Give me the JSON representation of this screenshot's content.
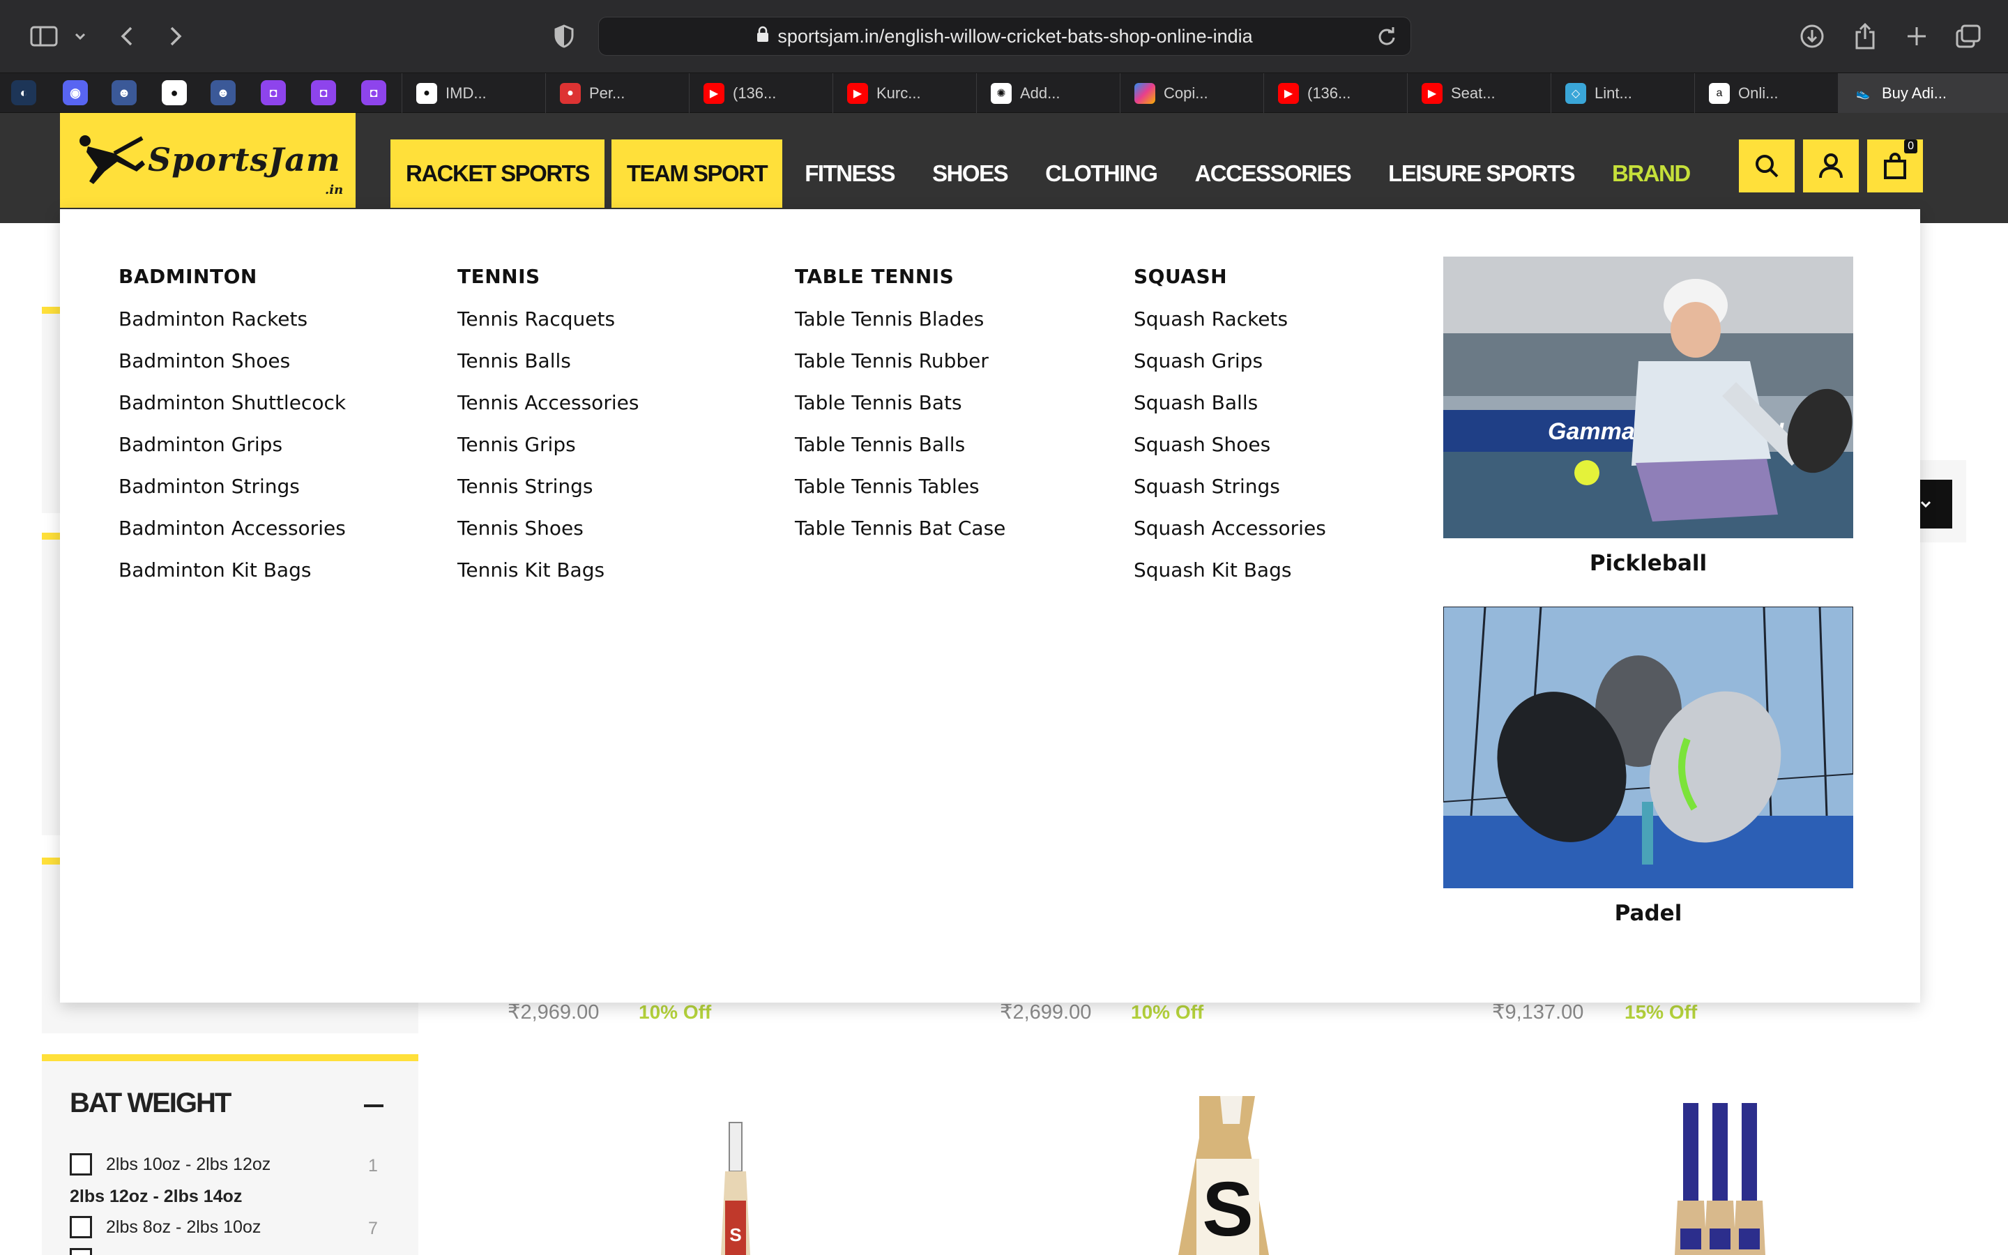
{
  "browser": {
    "url": "sportsjam.in/english-willow-cricket-bats-shop-online-india",
    "tabs": [
      {
        "label": "IMD...",
        "icon": "github-icon"
      },
      {
        "label": "Per...",
        "icon": "app-icon"
      },
      {
        "label": "(136...",
        "icon": "youtube-icon"
      },
      {
        "label": "Kurc...",
        "icon": "youtube-icon"
      },
      {
        "label": "Add...",
        "icon": "openai-icon"
      },
      {
        "label": "Copi...",
        "icon": "copilot-icon"
      },
      {
        "label": "(136...",
        "icon": "youtube-icon"
      },
      {
        "label": "Seat...",
        "icon": "youtube-icon"
      },
      {
        "label": "Lint...",
        "icon": "lint-icon"
      },
      {
        "label": "Onli...",
        "icon": "amazon-icon"
      },
      {
        "label": "Buy Adi...",
        "icon": "shoe-icon"
      }
    ]
  },
  "header": {
    "logo_text": "SportsJam",
    "logo_tld": ".in",
    "nav": [
      "RACKET SPORTS",
      "TEAM SPORT",
      "FITNESS",
      "SHOES",
      "CLOTHING",
      "ACCESSORIES",
      "LEISURE SPORTS",
      "BRAND"
    ],
    "cart_count": "0",
    "accent": "#ffe03a"
  },
  "mega": {
    "columns": [
      {
        "title": "BADMINTON",
        "items": [
          "Badminton Rackets",
          "Badminton Shoes",
          "Badminton Shuttlecock",
          "Badminton Grips",
          "Badminton Strings",
          "Badminton Accessories",
          "Badminton Kit Bags"
        ]
      },
      {
        "title": "TENNIS",
        "items": [
          "Tennis Racquets",
          "Tennis Balls",
          "Tennis Accessories",
          "Tennis Grips",
          "Tennis Strings",
          "Tennis Shoes",
          "Tennis Kit Bags"
        ]
      },
      {
        "title": "TABLE TENNIS",
        "items": [
          "Table Tennis Blades",
          "Table Tennis Rubber",
          "Table Tennis Bats",
          "Table Tennis Balls",
          "Table Tennis Tables",
          "Table Tennis Bat Case"
        ]
      },
      {
        "title": "SQUASH",
        "items": [
          "Squash Rackets",
          "Squash Grips",
          "Squash Balls",
          "Squash Shoes",
          "Squash Strings",
          "Squash Accessories",
          "Squash Kit Bags"
        ]
      }
    ],
    "promos": [
      {
        "caption": "Pickleball",
        "banner_text": "Gamma PICKLEBALL"
      },
      {
        "caption": "Padel"
      }
    ]
  },
  "products": [
    {
      "price": "₹2,969.00",
      "discount": "10% Off"
    },
    {
      "price": "₹2,699.00",
      "discount": "10% Off"
    },
    {
      "price": "₹9,137.00",
      "discount": "15% Off"
    }
  ],
  "filter": {
    "title": "BAT WEIGHT",
    "options": [
      {
        "label": "2lbs 10oz - 2lbs 12oz",
        "count": "1"
      },
      {
        "label": "2lbs 8oz - 2lbs 10oz",
        "count": "7"
      }
    ],
    "group_label": "2lbs 12oz - 2lbs 14oz"
  }
}
